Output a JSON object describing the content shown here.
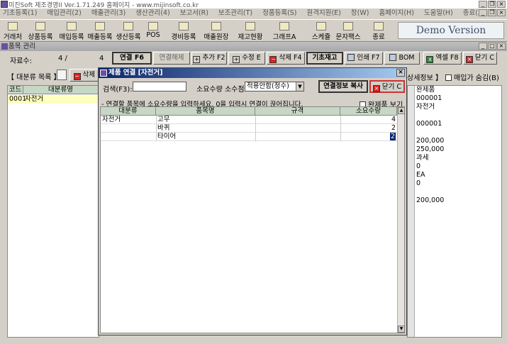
{
  "window": {
    "title": "미진Soft 제조경영II Ver.1.71.249       홈페이지 - www.mijinsoft.co.kr"
  },
  "menu": [
    "기초등록(1)",
    "매입관리(2)",
    "매출관리(3)",
    "생산관리(4)",
    "보고서(R)",
    "보조관리(T)",
    "정품등록(S)",
    "원격지원(E)",
    "창(W)",
    "홈페이지(H)",
    "도움말(H)",
    "종료(X)"
  ],
  "toolbar": {
    "items": [
      "거래처",
      "상품등록",
      "매입등록",
      "매출등록",
      "생산등록",
      "POS",
      "경비등록",
      "매출원장",
      "재고현황",
      "그래프A",
      "스케쥴",
      "문자팩스",
      "종료"
    ],
    "demo_label": "Demo Version"
  },
  "inner_window": {
    "title": "품목 관리",
    "record_label": "자료수:",
    "record_current": "4 /",
    "record_total": "4",
    "buttons": {
      "link": "연결 F6",
      "unlink": "연결해제",
      "add": "추가 F2",
      "edit": "수정 E",
      "delete": "삭제 F4",
      "base_stock": "기초재고",
      "print": "인쇄 F7",
      "bom": "BOM",
      "excel": "엑셀 F8",
      "close": "닫기 C"
    }
  },
  "category_panel": {
    "title": "【 대분류 목록 】",
    "delete_label": "삭제 F",
    "headers": [
      "코드",
      "대분류명"
    ],
    "rows": [
      {
        "code": "0001",
        "name": "자전거"
      }
    ]
  },
  "detail_panel": {
    "title": "상세정보 】",
    "hide_purchase_label": "매입가 숨김(B)",
    "values": [
      "완제품",
      "000001",
      "자전거",
      "",
      "000001",
      "",
      "200,000",
      "250,000",
      "과세",
      "0",
      "EA",
      "0",
      "",
      "200,000"
    ]
  },
  "dialog": {
    "title": "제품 연결 [자전거]",
    "search_label": "검색(F3):",
    "search_value": "",
    "qty_decimal_label": "소요수량 소수점:",
    "qty_decimal_value": "적용안함(정수)",
    "copy_button": "연결정보 복사",
    "close_button": "닫기 C",
    "instruction": "- 연결할 품목에 소요수량을 입력하세요.  0을 입력시 연결이 끊어집니다.",
    "show_finished_label": "완제품 보기",
    "headers": [
      "대분류",
      "품목명",
      "규격",
      "소요수량"
    ],
    "rows": [
      {
        "category": "자전거",
        "name": "고무",
        "spec": "",
        "qty": "4"
      },
      {
        "category": "",
        "name": "바퀴",
        "spec": "",
        "qty": "2"
      },
      {
        "category": "",
        "name": "타이어",
        "spec": "",
        "qty": "2"
      }
    ]
  }
}
